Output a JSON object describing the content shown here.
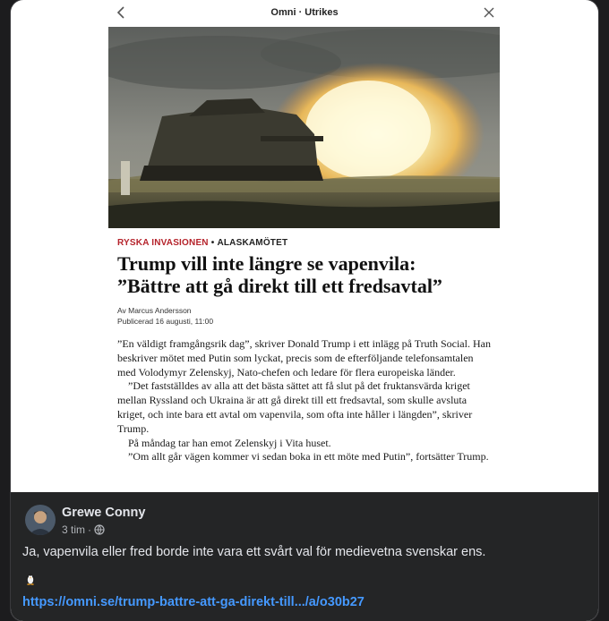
{
  "article_view": {
    "source_title": "Omni · Utrikes",
    "back_icon": "chevron-left-icon",
    "close_icon": "close-icon"
  },
  "article": {
    "kicker_topic": "RYSKA INVASIONEN",
    "kicker_separator": "•",
    "kicker_subtopic": "ALASKAMÖTET",
    "headline_line1": "Trump vill inte längre se vapenvila:",
    "headline_line2": "”Bättre att gå direkt till ett fredsavtal”",
    "byline": "Av Marcus Andersson",
    "published": "Publicerad 16 augusti, 11:00",
    "paragraphs": [
      "”En väldigt framgångsrik dag”, skriver Donald Trump i ett inlägg på Truth Social. Han beskriver mötet med Putin som lyckat, precis som de efterföljande telefonsamtalen med Volodymyr Zelenskyj, Nato-chefen och ledare för flera europeiska länder.",
      "”Det fastställdes av alla att det bästa sättet att få slut på det fruktansvärda kriget mellan Ryssland och Ukraina är att gå direkt till ett fredsavtal, som skulle avsluta kriget, och inte bara ett avtal om vapenvila, som ofta inte håller i längden”, skriver Trump.",
      "På måndag tar han emot Zelenskyj i Vita huset.",
      "”Om allt går vägen kommer vi sedan boka in ett möte med Putin”, fortsätter Trump."
    ],
    "kicker_color": "#b5232b"
  },
  "post": {
    "author": "Grewe Conny",
    "time": "3 tim",
    "meta_separator": "·",
    "audience_icon": "globe-icon",
    "text": "Ja, vapenvila eller fred borde inte vara ett svårt val för medievetna svenskar ens.",
    "emoji_icon": "penguin-icon",
    "link": "https://omni.se/trump-battre-att-ga-direkt-till.../a/o30b27",
    "link_color": "#4599ff"
  }
}
